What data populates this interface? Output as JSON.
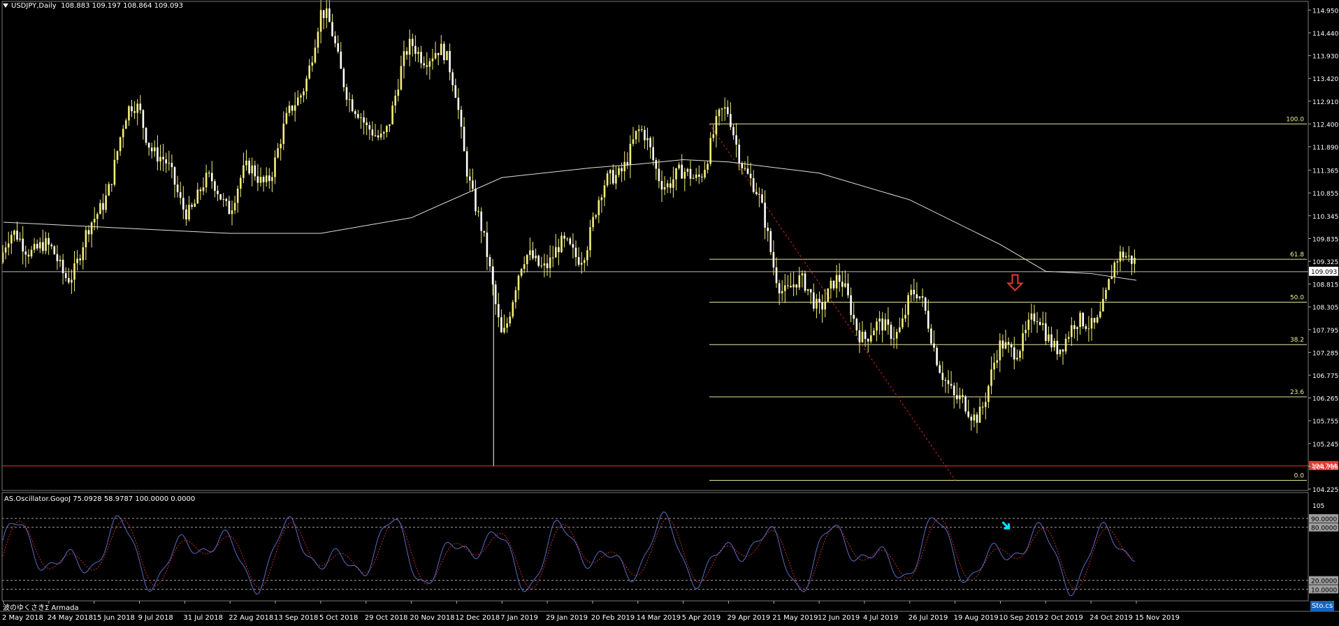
{
  "header": {
    "symbol": "USDJPY,Daily",
    "ohlc": "108.883 109.197 108.864 109.093"
  },
  "oscillator": {
    "title": "AS.Oscillator.GogoJ 75.0928 58.9787 100.0000 0.0000",
    "levels": [
      {
        "label": "90.0000",
        "value": 90
      },
      {
        "label": "80.0000",
        "value": 80
      },
      {
        "label": "20.0000",
        "value": 20
      },
      {
        "label": "10.0000",
        "value": 10
      }
    ],
    "top_label": "105"
  },
  "footer": {
    "label": "波のゆくさきΣ Armada",
    "badge": "Sto.cs"
  },
  "chart_data": {
    "type": "candlestick",
    "symbol": "USDJPY",
    "timeframe": "Daily",
    "y_ticks": [
      "114.950",
      "114.440",
      "113.930",
      "113.420",
      "112.910",
      "112.400",
      "111.890",
      "111.365",
      "110.855",
      "110.345",
      "109.835",
      "109.325",
      "108.815",
      "108.305",
      "107.795",
      "107.285",
      "106.775",
      "106.265",
      "105.755",
      "105.245",
      "104.735",
      "104.225"
    ],
    "ylim": [
      104.1,
      115.05
    ],
    "x_ticks": [
      "2 May 2018",
      "24 May 2018",
      "15 Jun 2018",
      "9 Jul 2018",
      "31 Jul 2018",
      "22 Aug 2018",
      "13 Sep 2018",
      "5 Oct 2018",
      "29 Oct 2018",
      "20 Nov 2018",
      "12 Dec 2018",
      "7 Jan 2019",
      "29 Jan 2019",
      "20 Feb 2019",
      "14 Mar 2019",
      "5 Apr 2019",
      "29 Apr 2019",
      "21 May 2019",
      "12 Jun 2019",
      "4 Jul 2019",
      "26 Jul 2019",
      "19 Aug 2019",
      "10 Sep 2019",
      "2 Oct 2019",
      "24 Oct 2019",
      "15 Nov 2019"
    ],
    "current_price": {
      "label": "109.093",
      "value": 109.093
    },
    "support_line": {
      "label": "104.744",
      "value": 104.744,
      "color": "#e53935"
    },
    "fibonacci": {
      "high": 112.4,
      "low": 104.42,
      "levels": [
        {
          "label": "100.0",
          "value": 112.4
        },
        {
          "label": "61.8",
          "value": 109.37
        },
        {
          "label": "50.0",
          "value": 108.41
        },
        {
          "label": "38.2",
          "value": 107.46
        },
        {
          "label": "23.6",
          "value": 106.29
        },
        {
          "label": "0.0",
          "value": 104.42
        }
      ]
    },
    "path_points": [
      [
        "2 May 2018",
        109.3
      ],
      [
        "24 May 2018",
        109.3
      ],
      [
        "15 Jun 2018",
        110.3
      ],
      [
        "9 Jul 2018",
        112.4
      ],
      [
        "31 Jul 2018",
        111.2
      ],
      [
        "22 Aug 2018",
        110.2
      ],
      [
        "13 Sep 2018",
        112.2
      ],
      [
        "5 Oct 2018",
        114.2
      ],
      [
        "29 Oct 2018",
        112.4
      ],
      [
        "20 Nov 2018",
        113.8
      ],
      [
        "12 Dec 2018",
        113.2
      ],
      [
        "7 Jan 2019",
        108.0
      ],
      [
        "29 Jan 2019",
        109.2
      ],
      [
        "20 Feb 2019",
        110.6
      ],
      [
        "14 Mar 2019",
        111.5
      ],
      [
        "5 Apr 2019",
        111.6
      ],
      [
        "29 Apr 2019",
        112.0
      ],
      [
        "21 May 2019",
        109.8
      ],
      [
        "12 Jun 2019",
        108.2
      ],
      [
        "4 Jul 2019",
        108.0
      ],
      [
        "26 Jul 2019",
        108.5
      ],
      [
        "19 Aug 2019",
        105.8
      ],
      [
        "10 Sep 2019",
        107.5
      ],
      [
        "2 Oct 2019",
        107.2
      ],
      [
        "24 Oct 2019",
        108.6
      ],
      [
        "15 Nov 2019",
        109.1
      ]
    ],
    "moving_average": [
      [
        "2 May 2018",
        110.2
      ],
      [
        "15 Jun 2018",
        110.1
      ],
      [
        "22 Aug 2018",
        109.95
      ],
      [
        "5 Oct 2018",
        109.95
      ],
      [
        "20 Nov 2018",
        110.3
      ],
      [
        "7 Jan 2019",
        111.2
      ],
      [
        "20 Feb 2019",
        111.42
      ],
      [
        "14 Mar 2019",
        111.5
      ],
      [
        "5 Apr 2019",
        111.6
      ],
      [
        "29 Apr 2019",
        111.55
      ],
      [
        "12 Jun 2019",
        111.3
      ],
      [
        "26 Jul 2019",
        110.7
      ],
      [
        "10 Sep 2019",
        109.7
      ],
      [
        "2 Oct 2019",
        109.1
      ],
      [
        "24 Oct 2019",
        109.05
      ],
      [
        "15 Nov 2019",
        108.9
      ]
    ],
    "annotations": [
      {
        "type": "down-arrow",
        "date": "10 Sep 2019",
        "value": 108.8,
        "color": "#e53935"
      },
      {
        "type": "down-right-arrow",
        "panel": "oscillator",
        "date": "10 Sep 2019",
        "value": 82,
        "color": "#00e5ff"
      }
    ]
  }
}
